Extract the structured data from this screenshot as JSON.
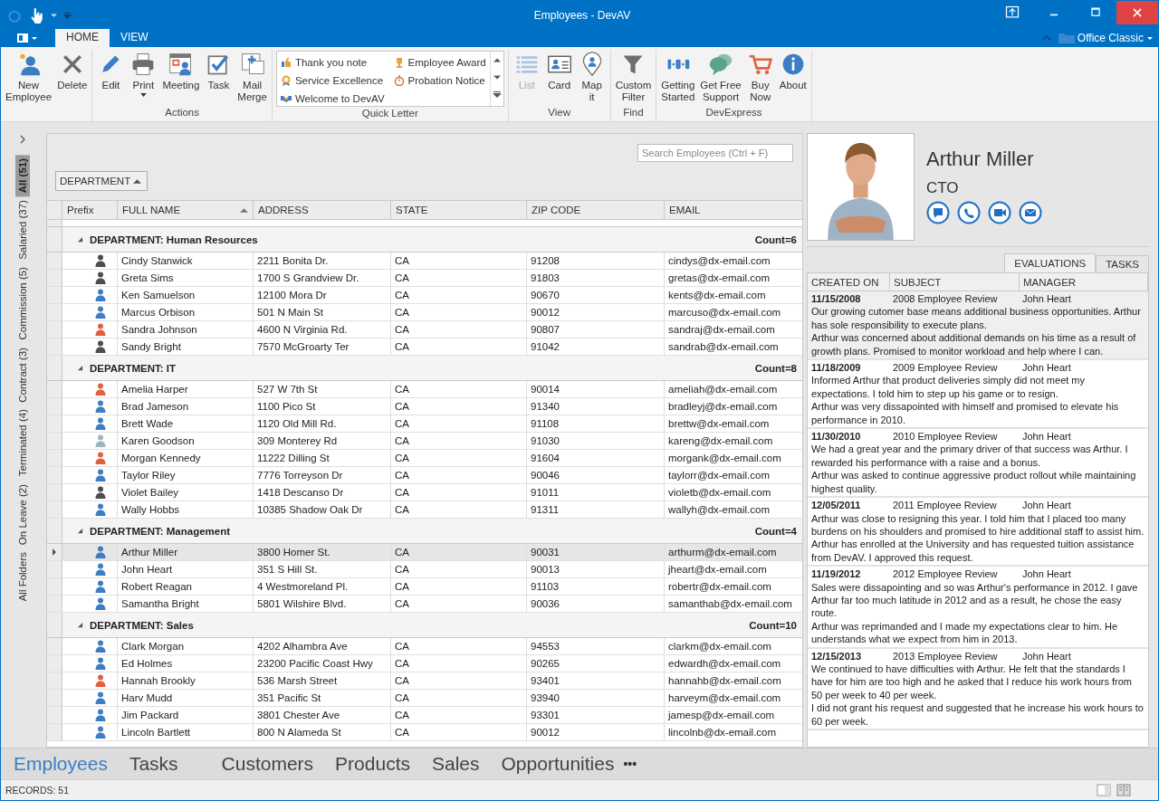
{
  "window": {
    "title": "Employees - DevAV"
  },
  "ribbon": {
    "tabs": [
      {
        "label": "HOME",
        "selected": true
      },
      {
        "label": "VIEW",
        "selected": false
      }
    ],
    "skin": "Office Classic",
    "groups": [
      {
        "kind": "buttons",
        "buttons": [
          {
            "label": "New\nEmployee",
            "disabled": false,
            "dropdown": false
          },
          {
            "label": "Delete",
            "disabled": false,
            "dropdown": false
          }
        ]
      },
      {
        "kind": "buttons",
        "label": "Actions",
        "buttons": [
          {
            "label": "Edit",
            "disabled": false,
            "dropdown": false
          },
          {
            "label": "Print",
            "disabled": false,
            "dropdown": true
          },
          {
            "label": "Meeting",
            "disabled": false,
            "dropdown": false
          },
          {
            "label": "Task",
            "disabled": false,
            "dropdown": false
          },
          {
            "label": "Mail\nMerge",
            "disabled": false,
            "dropdown": false
          }
        ]
      },
      {
        "kind": "gallery",
        "label": "Quick Letter",
        "items": [
          "Thank you note",
          "Employee Award",
          "Service Excellence",
          "Probation Notice",
          "Welcome to DevAV"
        ]
      },
      {
        "kind": "buttons",
        "label": "View",
        "buttons": [
          {
            "label": "List",
            "disabled": true,
            "dropdown": false
          },
          {
            "label": "Card",
            "disabled": false,
            "dropdown": false
          },
          {
            "label": "Map\nit",
            "disabled": false,
            "dropdown": false
          }
        ]
      },
      {
        "kind": "buttons",
        "label": "Find",
        "buttons": [
          {
            "label": "Custom\nFilter",
            "disabled": false,
            "dropdown": false
          }
        ]
      },
      {
        "kind": "buttons",
        "label": "DevExpress",
        "buttons": [
          {
            "label": "Getting\nStarted",
            "disabled": false,
            "dropdown": false
          },
          {
            "label": "Get Free\nSupport",
            "disabled": false,
            "dropdown": false
          },
          {
            "label": "Buy\nNow",
            "disabled": false,
            "dropdown": false
          },
          {
            "label": "About",
            "disabled": false,
            "dropdown": false
          }
        ]
      }
    ]
  },
  "folders": [
    {
      "label": "All (51)",
      "selected": true
    },
    {
      "label": "Salaried (37)",
      "selected": false
    },
    {
      "label": "Commission (5)",
      "selected": false
    },
    {
      "label": "Contract (3)",
      "selected": false
    },
    {
      "label": "Terminated (4)",
      "selected": false
    },
    {
      "label": "On Leave (2)",
      "selected": false
    },
    {
      "label": "All Folders",
      "selected": false
    }
  ],
  "grid": {
    "search": {
      "placeholder": "Search Employees (Ctrl + F)"
    },
    "group_by": "DEPARTMENT",
    "columns": [
      {
        "label": "Prefix",
        "sorted": false
      },
      {
        "label": "FULL NAME",
        "sorted": true
      },
      {
        "label": "ADDRESS",
        "sorted": false
      },
      {
        "label": "STATE",
        "sorted": false
      },
      {
        "label": "ZIP CODE",
        "sorted": false
      },
      {
        "label": "EMAIL",
        "sorted": false
      }
    ],
    "groups": [
      {
        "title": "DEPARTMENT: Human Resources",
        "count": "Count=6",
        "expanded": true,
        "rows": [
          {
            "color": "#4d4d4d",
            "name": "Cindy Stanwick",
            "address": "2211 Bonita Dr.",
            "state": "CA",
            "zip": "91208",
            "email": "cindys@dx-email.com",
            "selected": false
          },
          {
            "color": "#4d4d4d",
            "name": "Greta Sims",
            "address": "1700 S Grandview Dr.",
            "state": "CA",
            "zip": "91803",
            "email": "gretas@dx-email.com",
            "selected": false
          },
          {
            "color": "#3c7dc4",
            "name": "Ken Samuelson",
            "address": "12100 Mora Dr",
            "state": "CA",
            "zip": "90670",
            "email": "kents@dx-email.com",
            "selected": false
          },
          {
            "color": "#3c7dc4",
            "name": "Marcus Orbison",
            "address": "501 N Main St",
            "state": "CA",
            "zip": "90012",
            "email": "marcuso@dx-email.com",
            "selected": false
          },
          {
            "color": "#e2603f",
            "name": "Sandra Johnson",
            "address": "4600 N Virginia Rd.",
            "state": "CA",
            "zip": "90807",
            "email": "sandraj@dx-email.com",
            "selected": false
          },
          {
            "color": "#4d4d4d",
            "name": "Sandy Bright",
            "address": "7570 McGroarty Ter",
            "state": "CA",
            "zip": "91042",
            "email": "sandrab@dx-email.com",
            "selected": false
          }
        ]
      },
      {
        "title": "DEPARTMENT: IT",
        "count": "Count=8",
        "expanded": true,
        "rows": [
          {
            "color": "#e2603f",
            "name": "Amelia Harper",
            "address": "527 W 7th St",
            "state": "CA",
            "zip": "90014",
            "email": "ameliah@dx-email.com",
            "selected": false
          },
          {
            "color": "#3c7dc4",
            "name": "Brad Jameson",
            "address": "1100 Pico St",
            "state": "CA",
            "zip": "91340",
            "email": "bradleyj@dx-email.com",
            "selected": false
          },
          {
            "color": "#3c7dc4",
            "name": "Brett Wade",
            "address": "1120 Old Mill Rd.",
            "state": "CA",
            "zip": "91108",
            "email": "brettw@dx-email.com",
            "selected": false
          },
          {
            "color": "#9fb4bc",
            "name": "Karen Goodson",
            "address": "309 Monterey Rd",
            "state": "CA",
            "zip": "91030",
            "email": "kareng@dx-email.com",
            "selected": false
          },
          {
            "color": "#e2603f",
            "name": "Morgan Kennedy",
            "address": "11222 Dilling St",
            "state": "CA",
            "zip": "91604",
            "email": "morgank@dx-email.com",
            "selected": false
          },
          {
            "color": "#3c7dc4",
            "name": "Taylor Riley",
            "address": "7776 Torreyson Dr",
            "state": "CA",
            "zip": "90046",
            "email": "taylorr@dx-email.com",
            "selected": false
          },
          {
            "color": "#4d4d4d",
            "name": "Violet Bailey",
            "address": "1418 Descanso Dr",
            "state": "CA",
            "zip": "91011",
            "email": "violetb@dx-email.com",
            "selected": false
          },
          {
            "color": "#3c7dc4",
            "name": "Wally Hobbs",
            "address": "10385 Shadow Oak Dr",
            "state": "CA",
            "zip": "91311",
            "email": "wallyh@dx-email.com",
            "selected": false
          }
        ]
      },
      {
        "title": "DEPARTMENT: Management",
        "count": "Count=4",
        "expanded": true,
        "rows": [
          {
            "color": "#3c7dc4",
            "name": "Arthur Miller",
            "address": "3800 Homer St.",
            "state": "CA",
            "zip": "90031",
            "email": "arthurm@dx-email.com",
            "selected": true
          },
          {
            "color": "#3c7dc4",
            "name": "John Heart",
            "address": "351 S Hill St.",
            "state": "CA",
            "zip": "90013",
            "email": "jheart@dx-email.com",
            "selected": false
          },
          {
            "color": "#3c7dc4",
            "name": "Robert Reagan",
            "address": "4 Westmoreland Pl.",
            "state": "CA",
            "zip": "91103",
            "email": "robertr@dx-email.com",
            "selected": false
          },
          {
            "color": "#3c7dc4",
            "name": "Samantha Bright",
            "address": "5801 Wilshire Blvd.",
            "state": "CA",
            "zip": "90036",
            "email": "samanthab@dx-email.com",
            "selected": false
          }
        ]
      },
      {
        "title": "DEPARTMENT: Sales",
        "count": "Count=10",
        "expanded": true,
        "rows": [
          {
            "color": "#3c7dc4",
            "name": "Clark Morgan",
            "address": "4202 Alhambra Ave",
            "state": "CA",
            "zip": "94553",
            "email": "clarkm@dx-email.com",
            "selected": false
          },
          {
            "color": "#3c7dc4",
            "name": "Ed Holmes",
            "address": "23200 Pacific Coast Hwy",
            "state": "CA",
            "zip": "90265",
            "email": "edwardh@dx-email.com",
            "selected": false
          },
          {
            "color": "#e2603f",
            "name": "Hannah Brookly",
            "address": "536 Marsh Street",
            "state": "CA",
            "zip": "93401",
            "email": "hannahb@dx-email.com",
            "selected": false
          },
          {
            "color": "#3c7dc4",
            "name": "Harv Mudd",
            "address": "351 Pacific St",
            "state": "CA",
            "zip": "93940",
            "email": "harveym@dx-email.com",
            "selected": false
          },
          {
            "color": "#3c7dc4",
            "name": "Jim Packard",
            "address": "3801 Chester Ave",
            "state": "CA",
            "zip": "93301",
            "email": "jamesp@dx-email.com",
            "selected": false
          },
          {
            "color": "#3c7dc4",
            "name": "Lincoln Bartlett",
            "address": "800 N Alameda St",
            "state": "CA",
            "zip": "90012",
            "email": "lincolnb@dx-email.com",
            "selected": false
          }
        ]
      }
    ]
  },
  "profile": {
    "name": "Arthur Miller",
    "title": "CTO",
    "tabs": [
      {
        "label": "EVALUATIONS",
        "selected": true
      },
      {
        "label": "TASKS",
        "selected": false
      }
    ],
    "columns": [
      "CREATED ON",
      "SUBJECT",
      "MANAGER"
    ],
    "evaluations": [
      {
        "date": "11/15/2008",
        "subject": "2008 Employee Review",
        "manager": "John Heart",
        "selected": true,
        "notes": [
          "Our growing cutomer base means additional business opportunities. Arthur has sole responsibility to execute plans.",
          "Arthur was concerned about additional demands on his time as a result of growth plans. Promised to monitor workload and help where I can."
        ]
      },
      {
        "date": "11/18/2009",
        "subject": "2009 Employee Review",
        "manager": "John Heart",
        "selected": false,
        "notes": [
          "Informed Arthur that product deliveries simply did not meet my expectations. I told him to step up his game or to resign.",
          "Arthur was very dissapointed with himself and promised to elevate his performance in 2010."
        ]
      },
      {
        "date": "11/30/2010",
        "subject": "2010 Employee Review",
        "manager": "John Heart",
        "selected": false,
        "notes": [
          "We had a great year and the primary driver of that success was Arthur. I rewarded his performance with a raise and a bonus.",
          "Arthur was asked to continue aggressive product rollout while maintaining highest quality."
        ]
      },
      {
        "date": "12/05/2011",
        "subject": "2011 Employee Review",
        "manager": "John Heart",
        "selected": false,
        "notes": [
          "Arthur was close to resigning this year. I told him that I placed too many burdens on his shoulders and promised to hire additional staff to assist him.",
          "Arthur has enrolled at the University and has requested tuition assistance from DevAV. I approved this request."
        ]
      },
      {
        "date": "11/19/2012",
        "subject": "2012 Employee Review",
        "manager": "John Heart",
        "selected": false,
        "notes": [
          "Sales were dissapointing and so was Arthur's performance in 2012. I gave Arthur far too much latitude in 2012 and as a result, he chose the easy route.",
          "Arthur was reprimanded and I made my expectations clear to him. He understands what we expect from him in 2013."
        ]
      },
      {
        "date": "12/15/2013",
        "subject": "2013 Employee Review",
        "manager": "John Heart",
        "selected": false,
        "notes": [
          "We continued to have difficulties with Arthur. He felt that the standards I have for him are too high and he asked that I reduce his work hours from 50 per week to 40 per week.",
          "I did not grant his request and suggested that he increase his work hours to 60 per week."
        ]
      }
    ]
  },
  "nav": {
    "items": [
      {
        "label": "Employees",
        "selected": true
      },
      {
        "label": "Tasks",
        "selected": false
      },
      {
        "label": "Customers",
        "selected": false
      },
      {
        "label": "Products",
        "selected": false
      },
      {
        "label": "Sales",
        "selected": false
      },
      {
        "label": "Opportunities",
        "selected": false
      }
    ],
    "more": "•••"
  },
  "status_bar": {
    "records": "RECORDS: 51"
  }
}
